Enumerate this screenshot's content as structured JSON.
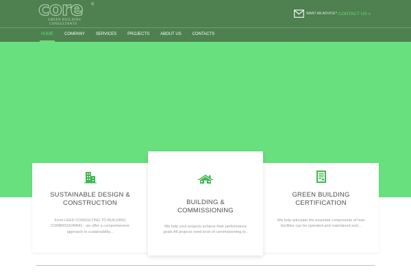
{
  "brand": {
    "name": "core",
    "reg_mark": "®",
    "tagline_line1": "GREEN BUILDING",
    "tagline_line2": "CONSULTANTS"
  },
  "contact": {
    "question": "WANT AN ADVICE?",
    "link_label": "CONTACT US »",
    "icon": "envelope-icon"
  },
  "nav": {
    "items": [
      {
        "label": "HOME",
        "active": true
      },
      {
        "label": "COMPANY",
        "active": false
      },
      {
        "label": "SERVICES",
        "active": false
      },
      {
        "label": "PROJECTS",
        "active": false
      },
      {
        "label": "ABOUT US",
        "active": false
      },
      {
        "label": "CONTACTS",
        "active": false
      }
    ]
  },
  "services": [
    {
      "icon": "building-icon",
      "title_line1": "SUSTAINABLE DESIGN &",
      "title_line2": "CONSTRUCTION",
      "text_line1": "From LEED CONSULTING TO BUILDING",
      "text_line2": "COMMISSIONING ; we offer a comprehensive",
      "text_line3": "approach to sustainability..."
    },
    {
      "icon": "house-icon",
      "title_line1": "BUILDING &",
      "title_line2": "COMMISSIONING",
      "text_line1": "We help your projects achieve their performance",
      "text_line2": "goals All projects need level of commissioning to.."
    },
    {
      "icon": "certificate-icon",
      "title_line1": "GREEN BUILDING",
      "title_line2": "CERTIFICATION",
      "text_line1": "We help articulate the essential components of how",
      "text_line2": "facilities can be operated and maintained and..."
    }
  ],
  "colors": {
    "header_bg": "#4e8050",
    "hero_bg": "#67e07d",
    "accent": "#6bd97a",
    "icon_green": "#3fb752"
  }
}
